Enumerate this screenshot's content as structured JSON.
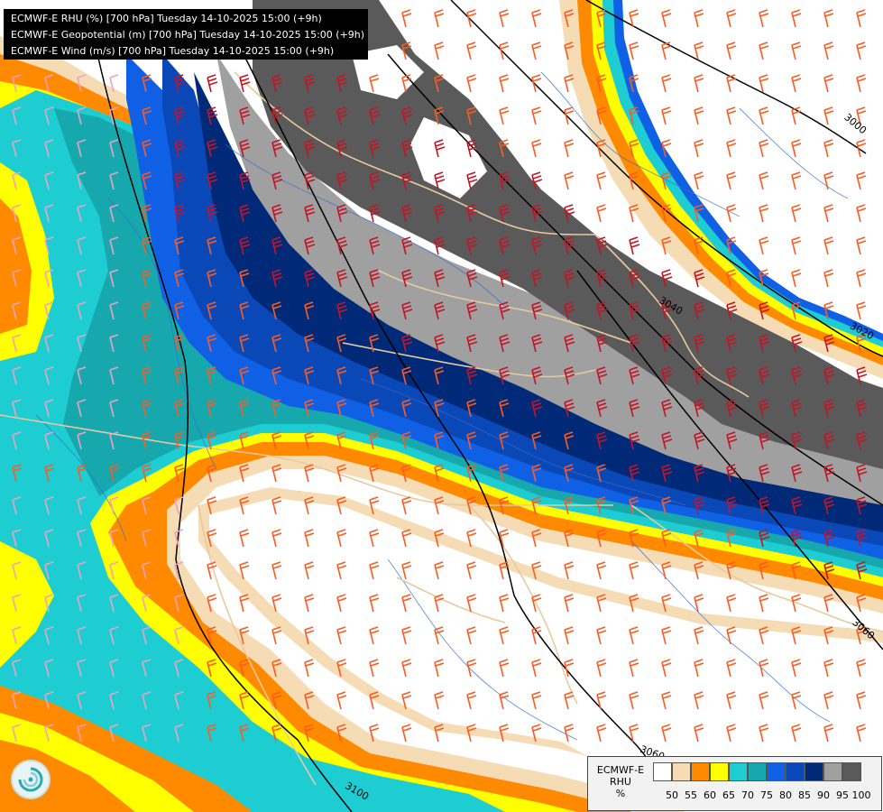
{
  "title_lines": [
    "ECMWF-E RHU (%) [700 hPa] Tuesday 14-10-2025 15:00 (+9h)",
    "ECMWF-E Geopotential (m) [700 hPa] Tuesday 14-10-2025 15:00 (+9h)",
    "ECMWF-E Wind (m/s) [700 hPa] Tuesday 14-10-2025 15:00 (+9h)"
  ],
  "legend": {
    "model": "ECMWF-E",
    "variable": "RHU",
    "unit": "%",
    "ticks": [
      "50",
      "55",
      "60",
      "65",
      "70",
      "75",
      "80",
      "85",
      "90",
      "95",
      "100"
    ],
    "colors": [
      "#ffffff",
      "#f5dcb4",
      "#ff8a00",
      "#ffff00",
      "#1ecdd2",
      "#17a8ae",
      "#1060e6",
      "#0a48b8",
      "#002a78",
      "#a0a0a0",
      "#5a5a5a"
    ]
  },
  "contour_labels": [
    "3000",
    "3020",
    "3040",
    "3060",
    "3080",
    "3100"
  ],
  "colors": {
    "wind_strong": "#cc1122",
    "wind_medium": "#ff5a1e",
    "wind_weak": "#f0a0c0",
    "border": "#e8caa0",
    "river": "#3a6cc8",
    "contour": "#000000"
  },
  "icons": {
    "logo": "ecmwf-swirl-icon",
    "wind": "wind-barb-icon"
  }
}
